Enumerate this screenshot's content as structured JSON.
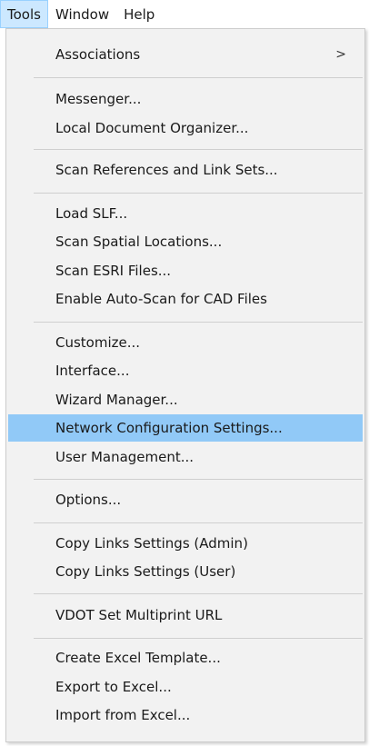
{
  "menubar": {
    "items": [
      {
        "label": "Tools"
      },
      {
        "label": "Window"
      },
      {
        "label": "Help"
      }
    ]
  },
  "tools_menu": {
    "items": [
      {
        "label": "Associations",
        "submenu_arrow": ">"
      },
      {
        "label": "Messenger..."
      },
      {
        "label": "Local Document Organizer..."
      },
      {
        "label": "Scan References and Link Sets..."
      },
      {
        "label": "Load SLF..."
      },
      {
        "label": "Scan Spatial Locations..."
      },
      {
        "label": "Scan ESRI Files..."
      },
      {
        "label": "Enable Auto-Scan for CAD Files"
      },
      {
        "label": "Customize..."
      },
      {
        "label": "Interface..."
      },
      {
        "label": "Wizard Manager..."
      },
      {
        "label": "Network Configuration Settings...",
        "highlighted": true
      },
      {
        "label": "User Management..."
      },
      {
        "label": "Options..."
      },
      {
        "label": "Copy Links Settings (Admin)"
      },
      {
        "label": "Copy Links Settings (User)"
      },
      {
        "label": "VDOT Set Multiprint URL"
      },
      {
        "label": "Create Excel Template..."
      },
      {
        "label": "Export to Excel..."
      },
      {
        "label": "Import from Excel..."
      }
    ]
  },
  "colors": {
    "menu_background": "#f2f2f2",
    "highlight": "#91c9f7",
    "menubar_active": "#cce8ff"
  }
}
